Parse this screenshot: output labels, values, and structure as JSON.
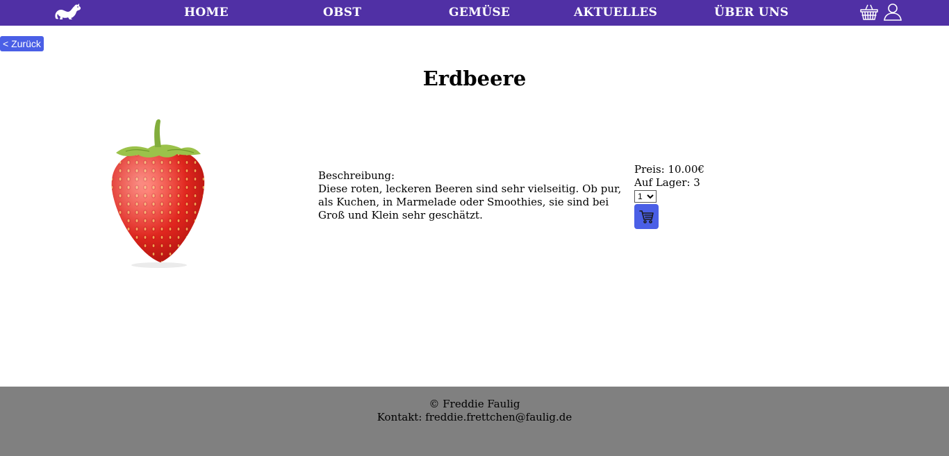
{
  "nav": {
    "links": [
      "HOME",
      "OBST",
      "GEMÜSE",
      "AKTUELLES",
      "ÜBER UNS"
    ],
    "color": "#5030a5"
  },
  "back_button": "< Zurück",
  "product": {
    "title": "Erdbeere",
    "description_label": "Beschreibung:",
    "description": "Diese roten, leckeren Beeren sind sehr vielseitig. Ob pur, als Kuchen, in Marmelade oder Smoothies, sie sind bei Groß und Klein sehr geschätzt.",
    "price": "Preis: 10.00€",
    "stock": "Auf Lager: 3",
    "quantity": "1"
  },
  "footer": {
    "copyright": "© Freddie Faulig",
    "contact": "Kontakt: freddie.frettchen@faulig.de"
  },
  "colors": {
    "accent_button": "#4a5fe6",
    "footer_bg": "#808080"
  },
  "icons": [
    "ferret-logo-icon",
    "basket-icon",
    "user-icon",
    "cart-icon",
    "strawberry-image"
  ]
}
